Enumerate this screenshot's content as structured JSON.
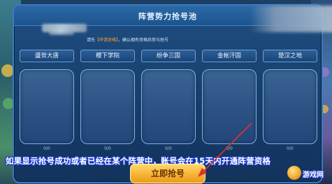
{
  "dialog": {
    "title": "阵营势力抢号池",
    "notice_prefix": "请先",
    "notice_highlight": "【申请资格】",
    "notice_suffix": "，确认拥有资格后参与抢号"
  },
  "camps": [
    {
      "name": "盛世大唐",
      "count": "0/0"
    },
    {
      "name": "稷下学院",
      "count": "0/0"
    },
    {
      "name": "纷争三国",
      "count": "0/0"
    },
    {
      "name": "金帐汗国",
      "count": "0/0"
    },
    {
      "name": "楚汉之地",
      "count": "0/0"
    }
  ],
  "caption": "如果显示抢号成功或者已经在某个阵营中，账号会在15天内开通阵营资格",
  "grab_button": "立即抢号",
  "watermark": "游戏网",
  "colors": {
    "dialog_bg": "#1a4577",
    "camp_border": "#7fb3e6",
    "button": "#f7b434",
    "caption_outline": "#1e3fd0",
    "notice_highlight": "#ff9a3d",
    "arrow": "#e0322a"
  }
}
